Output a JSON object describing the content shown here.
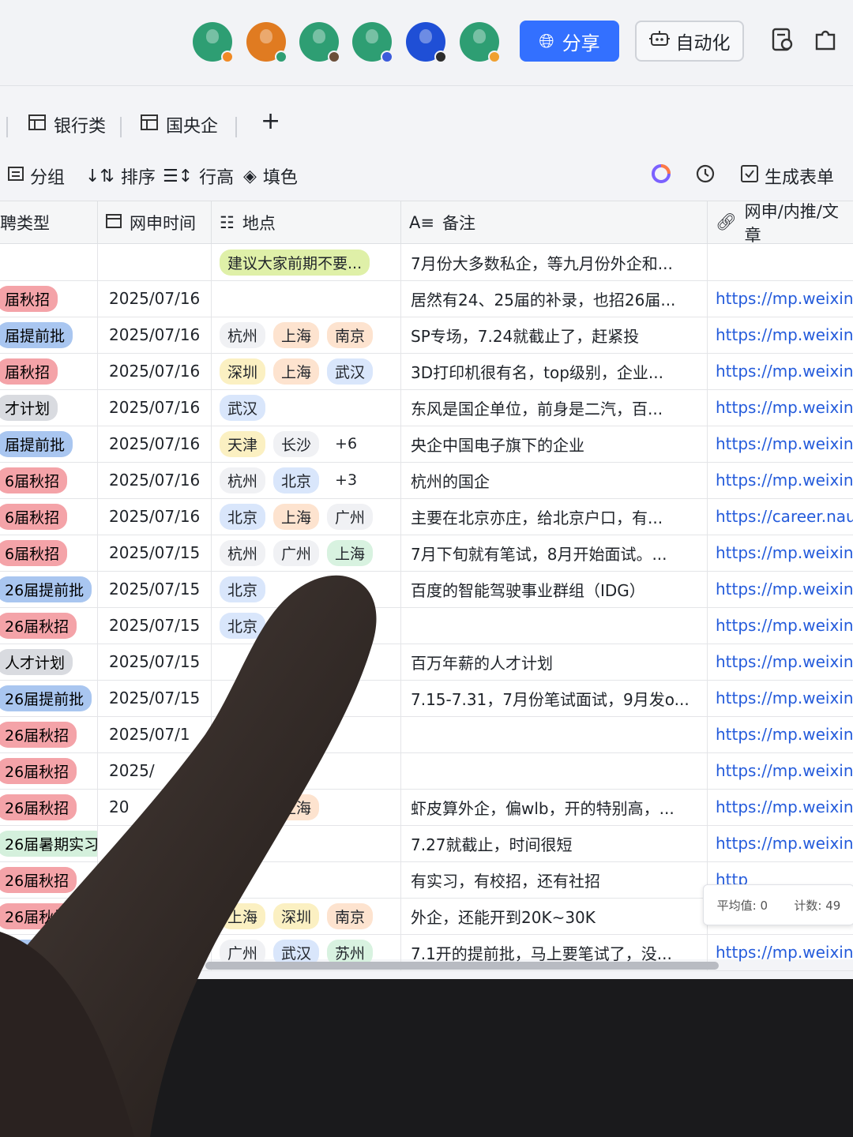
{
  "topbar": {
    "avatars": [
      {
        "color": "#2e9e73",
        "status": "#f08a24"
      },
      {
        "color": "#e07b21",
        "status": "#2e9e73"
      },
      {
        "color": "#2e9e73",
        "status": "#6b4f3a"
      },
      {
        "color": "#2e9e73",
        "status": "#3b5bdb"
      },
      {
        "color": "#1f4fd6",
        "status": "#2c2c2c"
      },
      {
        "color": "#2e9e73",
        "status": "#f0a030"
      }
    ],
    "share_label": "分享",
    "automation_label": "自动化"
  },
  "tabs": [
    {
      "label": "银行类"
    },
    {
      "label": "国央企"
    }
  ],
  "add_tab": "+",
  "toolbar": {
    "group": "分组",
    "sort": "排序",
    "row_height": "行高",
    "fill": "填色",
    "generate_form": "生成表单"
  },
  "columns": {
    "type": "聘类型",
    "date": "网申时间",
    "location": "地点",
    "note": "备注",
    "link": "网申/内推/文章"
  },
  "rows": [
    {
      "type": "",
      "type_color": "",
      "date": "",
      "locations": [
        {
          "t": "建议大家前期不要...",
          "c": "#dff0a8"
        }
      ],
      "note": "7月份大多数私企，等九月份外企和...",
      "link": ""
    },
    {
      "type": "届秋招",
      "type_color": "#f4a3a8",
      "date": "2025/07/16",
      "locations": [],
      "note": "居然有24、25届的补录，也招26届...",
      "link": "https://mp.weixin."
    },
    {
      "type": "届提前批",
      "type_color": "#a9c6f0",
      "date": "2025/07/16",
      "locations": [
        {
          "t": "杭州",
          "c": "#f0f1f4"
        },
        {
          "t": "上海",
          "c": "#fde3cf"
        },
        {
          "t": "南京",
          "c": "#fde3cf"
        }
      ],
      "note": "SP专场，7.24就截止了，赶紧投",
      "link": "https://mp.weixin.q"
    },
    {
      "type": "届秋招",
      "type_color": "#f4a3a8",
      "date": "2025/07/16",
      "locations": [
        {
          "t": "深圳",
          "c": "#fbf0c2"
        },
        {
          "t": "上海",
          "c": "#fde3cf"
        },
        {
          "t": "武汉",
          "c": "#d9e6fb"
        }
      ],
      "note": "3D打印机很有名，top级别，企业...",
      "link": "https://mp.weixin.q"
    },
    {
      "type": "才计划",
      "type_color": "#d9dbe0",
      "date": "2025/07/16",
      "locations": [
        {
          "t": "武汉",
          "c": "#d9e6fb"
        }
      ],
      "note": "东风是国企单位，前身是二汽，百...",
      "link": "https://mp.weixin.q"
    },
    {
      "type": "届提前批",
      "type_color": "#a9c6f0",
      "date": "2025/07/16",
      "locations": [
        {
          "t": "天津",
          "c": "#fbf0c2"
        },
        {
          "t": "长沙",
          "c": "#f0f1f4"
        },
        {
          "t": "+6",
          "c": "transparent"
        }
      ],
      "note": "央企中国电子旗下的企业",
      "link": "https://mp.weixin.qq"
    },
    {
      "type": "6届秋招",
      "type_color": "#f4a3a8",
      "date": "2025/07/16",
      "locations": [
        {
          "t": "杭州",
          "c": "#f0f1f4"
        },
        {
          "t": "北京",
          "c": "#d9e6fb"
        },
        {
          "t": "+3",
          "c": "transparent"
        }
      ],
      "note": "杭州的国企",
      "link": "https://mp.weixin.qq"
    },
    {
      "type": "6届秋招",
      "type_color": "#f4a3a8",
      "date": "2025/07/16",
      "locations": [
        {
          "t": "北京",
          "c": "#d9e6fb"
        },
        {
          "t": "上海",
          "c": "#fde3cf"
        },
        {
          "t": "广州",
          "c": "#f0f1f4"
        }
      ],
      "note": "主要在北京亦庄，给北京户口，有...",
      "link": "https://career.naura."
    },
    {
      "type": "6届秋招",
      "type_color": "#f4a3a8",
      "date": "2025/07/15",
      "locations": [
        {
          "t": "杭州",
          "c": "#f0f1f4"
        },
        {
          "t": "广州",
          "c": "#f0f1f4"
        },
        {
          "t": "上海",
          "c": "#d8f2e0"
        }
      ],
      "note": "7月下旬就有笔试，8月开始面试。...",
      "link": "https://mp.weixin.qq."
    },
    {
      "type": "26届提前批",
      "type_color": "#a9c6f0",
      "date": "2025/07/15",
      "locations": [
        {
          "t": "北京",
          "c": "#d9e6fb"
        }
      ],
      "note": "百度的智能驾驶事业群组（IDG）",
      "link": "https://mp.weixin.qq."
    },
    {
      "type": "26届秋招",
      "type_color": "#f4a3a8",
      "date": "2025/07/15",
      "locations": [
        {
          "t": "北京",
          "c": "#d9e6fb"
        }
      ],
      "note": "",
      "link": "https://mp.weixin.qq.c"
    },
    {
      "type": "人才计划",
      "type_color": "#d9dbe0",
      "date": "2025/07/15",
      "locations": [],
      "note": "百万年薪的人才计划",
      "link": "https://mp.weixin.qq.c"
    },
    {
      "type": "26届提前批",
      "type_color": "#a9c6f0",
      "date": "2025/07/15",
      "locations": [],
      "note": "7.15-7.31，7月份笔试面试，9月发o...",
      "link": "https://mp.weixin.qq.c"
    },
    {
      "type": "26届秋招",
      "type_color": "#f4a3a8",
      "date": "2025/07/1",
      "locations": [],
      "note": "",
      "link": "https://mp.weixin.qq.co"
    },
    {
      "type": "26届秋招",
      "type_color": "#f4a3a8",
      "date": "2025/",
      "locations": [],
      "note": "",
      "link": "https://mp.weixin.qq.co"
    },
    {
      "type": "26届秋招",
      "type_color": "#f4a3a8",
      "date": "20",
      "locations": [
        {
          "t": "北京",
          "c": "#d9e6fb"
        },
        {
          "t": "上海",
          "c": "#fde3cf"
        }
      ],
      "note": "虾皮算外企，偏wlb，开的特别高，...",
      "link": "https://mp.weixin.qq.co"
    },
    {
      "type": "26届暑期实习",
      "type_color": "#d4f0dc",
      "date": "",
      "locations": [],
      "note": "7.27就截止，时间很短",
      "link": "https://mp.weixin.qq.co."
    },
    {
      "type": "26届秋招",
      "type_color": "#f4a3a8",
      "date": "",
      "locations": [],
      "note": "有实习，有校招，还有社招",
      "link": "http"
    },
    {
      "type": "26届秋招",
      "type_color": "#f4a3a8",
      "date": "",
      "locations": [
        {
          "t": "上海",
          "c": "#fbf0c2"
        },
        {
          "t": "深圳",
          "c": "#fbf0c2"
        },
        {
          "t": "南京",
          "c": "#fde3cf"
        }
      ],
      "note": "外企，还能开到20K~30K",
      "link": "https://mp.weixin.qq.co..."
    },
    {
      "type": "26届提",
      "type_color": "#a9c6f0",
      "date": "",
      "locations": [
        {
          "t": "广州",
          "c": "#f0f1f4"
        },
        {
          "t": "武汉",
          "c": "#d9e6fb"
        },
        {
          "t": "苏州",
          "c": "#d8f2e0"
        }
      ],
      "note": "7.1开的提前批，马上要笔试了，没...",
      "link": "https://mp.weixin.qq.co..."
    }
  ],
  "status": {
    "average": "平均值: 0",
    "count": "计数: 49"
  }
}
